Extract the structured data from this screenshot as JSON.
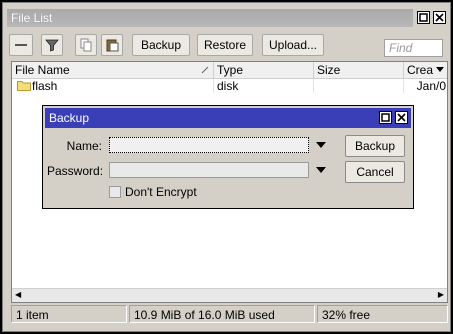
{
  "window": {
    "title": "File List"
  },
  "toolbar": {
    "backup_label": "Backup",
    "restore_label": "Restore",
    "upload_label": "Upload...",
    "search_placeholder": "Find"
  },
  "list": {
    "columns": [
      "File Name",
      "Type",
      "Size",
      "Crea"
    ],
    "rows": [
      {
        "name": "flash",
        "type": "disk",
        "size": "",
        "created": "Jan/0"
      }
    ]
  },
  "status": {
    "items": "1 item",
    "usage": "10.9 MiB of 16.0 MiB used",
    "free": "32% free"
  },
  "dialog": {
    "title": "Backup",
    "name_label": "Name:",
    "name_value": "",
    "password_label": "Password:",
    "password_value": "",
    "dont_encrypt_label": "Don't Encrypt",
    "dont_encrypt_checked": false,
    "backup_button": "Backup",
    "cancel_button": "Cancel"
  },
  "colors": {
    "dialog_titlebar": "#3a3fb8",
    "window_bg": "#d4d0c8"
  }
}
